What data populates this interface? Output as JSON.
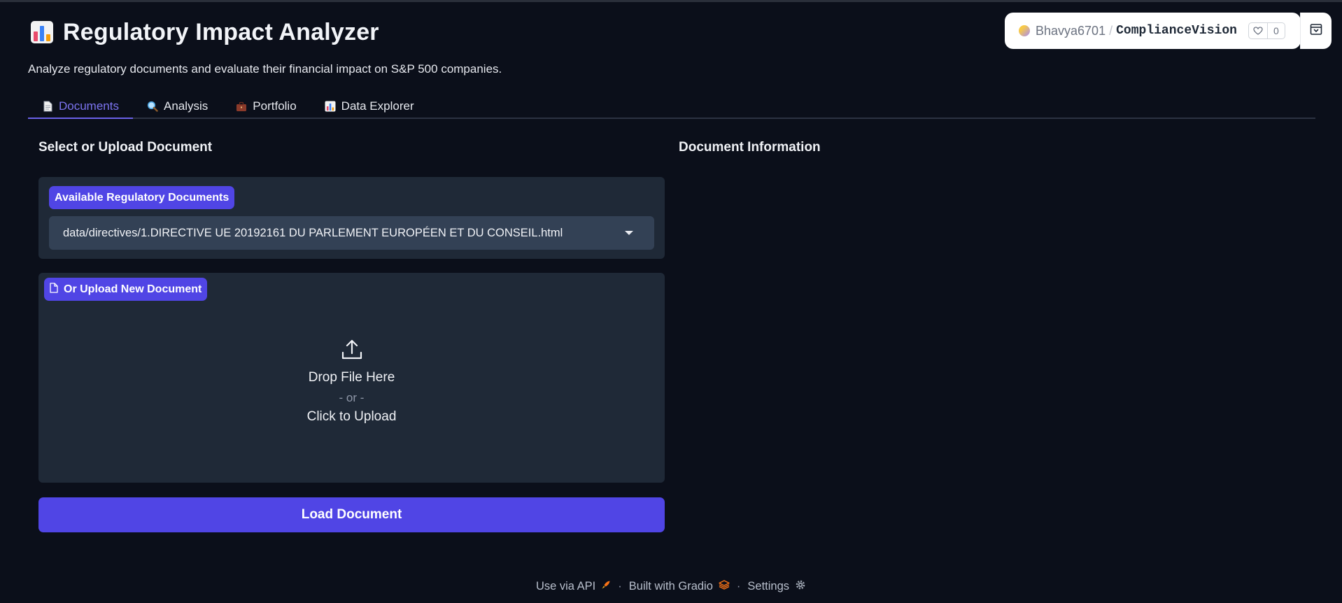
{
  "header": {
    "title": "Regulatory Impact Analyzer",
    "subtitle": "Analyze regulatory documents and evaluate their financial impact on S&P 500 companies."
  },
  "tabs": [
    {
      "label": "Documents",
      "icon": "document-icon",
      "active": true
    },
    {
      "label": "Analysis",
      "icon": "magnifier-icon",
      "active": false
    },
    {
      "label": "Portfolio",
      "icon": "briefcase-icon",
      "active": false
    },
    {
      "label": "Data Explorer",
      "icon": "bar-chart-icon",
      "active": false
    }
  ],
  "left": {
    "section_title": "Select or Upload Document",
    "dropdown": {
      "label": "Available Regulatory Documents",
      "selected": "data/directives/1.DIRECTIVE UE 20192161 DU PARLEMENT EUROPÉEN ET DU CONSEIL.html"
    },
    "upload": {
      "label": "Or Upload New Document",
      "drop_text": "Drop File Here",
      "or_text": "- or -",
      "click_text": "Click to Upload"
    },
    "load_button": "Load Document"
  },
  "right": {
    "section_title": "Document Information"
  },
  "footer": {
    "api": "Use via API",
    "gradio": "Built with Gradio",
    "settings": "Settings",
    "sep": "·"
  },
  "space_badge": {
    "user": "Bhavya6701",
    "slash": "/",
    "repo": "ComplianceVision",
    "likes": "0"
  },
  "colors": {
    "background": "#0b0f1a",
    "panel": "#1f2937",
    "accent": "#5045e5",
    "active_tab": "#7c74f0"
  }
}
